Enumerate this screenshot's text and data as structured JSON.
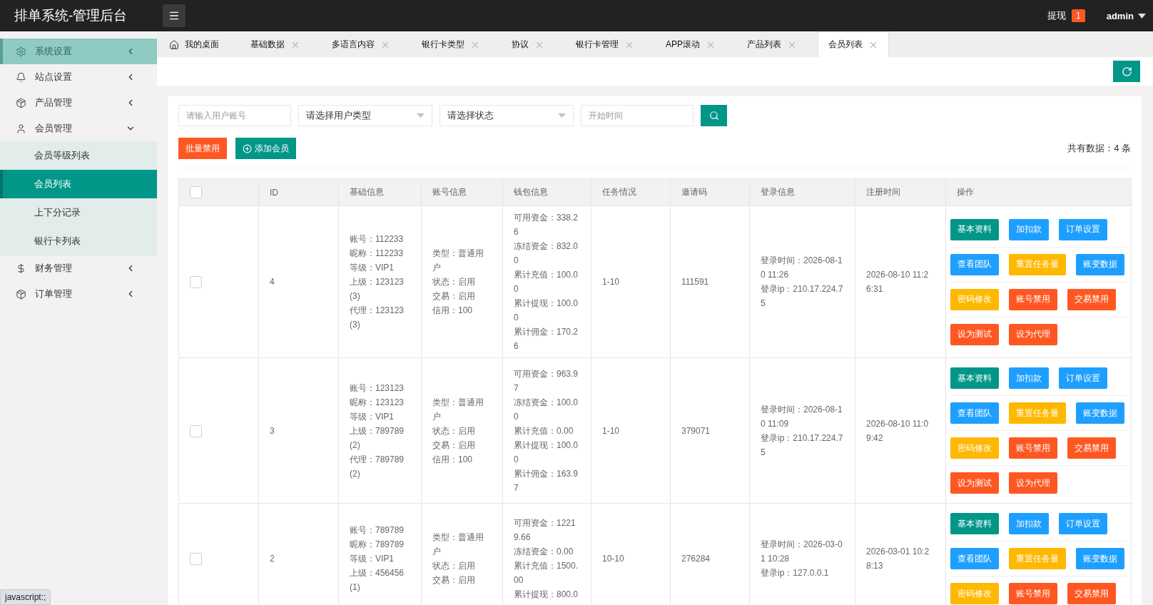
{
  "header": {
    "title": "排单系统-管理后台",
    "withdraw": {
      "label": "提现",
      "count": "1"
    },
    "user": "admin"
  },
  "sidebar": {
    "items": [
      {
        "label": "系统设置",
        "highlighted": true,
        "expanded": false
      },
      {
        "label": "站点设置",
        "highlighted": false,
        "expanded": false
      },
      {
        "label": "产品管理",
        "highlighted": false,
        "expanded": false
      },
      {
        "label": "会员管理",
        "highlighted": false,
        "expanded": true,
        "children": [
          {
            "label": "会员等级列表",
            "selected": false
          },
          {
            "label": "会员列表",
            "selected": true
          },
          {
            "label": "上下分记录",
            "selected": false
          },
          {
            "label": "银行卡列表",
            "selected": false
          }
        ]
      },
      {
        "label": "财务管理",
        "highlighted": false,
        "expanded": false
      },
      {
        "label": "订单管理",
        "highlighted": false,
        "expanded": false
      }
    ]
  },
  "tabs": [
    {
      "label": "我的桌面",
      "kind": "home",
      "selected": false
    },
    {
      "label": "基础数据",
      "kind": "closable",
      "selected": false
    },
    {
      "label": "多语言内容",
      "kind": "closable",
      "selected": false
    },
    {
      "label": "银行卡类型",
      "kind": "closable",
      "selected": false
    },
    {
      "label": "协议",
      "kind": "closable",
      "selected": false
    },
    {
      "label": "银行卡管理",
      "kind": "closable",
      "selected": false
    },
    {
      "label": "APP滚动",
      "kind": "closable",
      "selected": false
    },
    {
      "label": "产品列表",
      "kind": "closable",
      "selected": false
    },
    {
      "label": "会员列表",
      "kind": "closable",
      "selected": true
    }
  ],
  "filters": [
    {
      "kind": "text",
      "placeholder": "请输入用户账号"
    },
    {
      "kind": "select",
      "value": "请选择用户类型"
    },
    {
      "kind": "select",
      "value": "请选择状态"
    },
    {
      "kind": "text",
      "placeholder": "开始时间"
    }
  ],
  "toolbar": {
    "bulk_disable": "批量禁用",
    "add_member": "添加会员",
    "total": "共有数据：4 条"
  },
  "table": {
    "select_all_checked": false,
    "columns": [
      "ID",
      "基础信息",
      "账号信息",
      "钱包信息",
      "任务情况",
      "邀请码",
      "登录信息",
      "注册时间",
      "操作"
    ],
    "rows": [
      {
        "checked": false,
        "id": "4",
        "basic": [
          "账号：112233",
          "昵称：112233",
          "等级：VIP1",
          "上级：123123(3)",
          "代理：123123(3)"
        ],
        "account": [
          "类型：普通用户",
          "状态：启用",
          "交易：启用",
          "信用：100"
        ],
        "wallet": [
          "可用资金：338.26",
          "冻结资金：832.00",
          "累计充值：100.00",
          "累计提现：100.00",
          "累计佣金：170.26"
        ],
        "tasks": "1-10",
        "invite": "111591",
        "login": [
          "登录时间：2026-08-10 11:26",
          "登录ip：210.17.224.75"
        ],
        "registered": "2026-08-10 11:26:31",
        "actions": [
          [
            {
              "label": "基本资料",
              "kind": "primary"
            },
            {
              "label": "加扣款",
              "kind": "info"
            },
            {
              "label": "订单设置",
              "kind": "info"
            }
          ],
          [
            {
              "label": "查看团队",
              "kind": "info"
            },
            {
              "label": "重置任务量",
              "kind": "warn"
            },
            {
              "label": "账变数据",
              "kind": "info"
            }
          ],
          [
            {
              "label": "密码修改",
              "kind": "warn"
            },
            {
              "label": "账号禁用",
              "kind": "danger"
            },
            {
              "label": "交易禁用",
              "kind": "danger"
            }
          ],
          [
            {
              "label": "设为测试",
              "kind": "danger"
            },
            {
              "label": "设为代理",
              "kind": "danger"
            }
          ]
        ]
      },
      {
        "checked": false,
        "id": "3",
        "basic": [
          "账号：123123",
          "昵称：123123",
          "等级：VIP1",
          "上级：789789(2)",
          "代理：789789(2)"
        ],
        "account": [
          "类型：普通用户",
          "状态：启用",
          "交易：启用",
          "信用：100"
        ],
        "wallet": [
          "可用资金：963.97",
          "冻结资金：100.00",
          "累计充值：0.00",
          "累计提现：100.00",
          "累计佣金：163.97"
        ],
        "tasks": "1-10",
        "invite": "379071",
        "login": [
          "登录时间：2026-08-10 11:09",
          "登录ip：210.17.224.75"
        ],
        "registered": "2026-08-10 11:09:42",
        "actions": [
          [
            {
              "label": "基本资料",
              "kind": "primary"
            },
            {
              "label": "加扣款",
              "kind": "info"
            },
            {
              "label": "订单设置",
              "kind": "info"
            }
          ],
          [
            {
              "label": "查看团队",
              "kind": "info"
            },
            {
              "label": "重置任务量",
              "kind": "warn"
            },
            {
              "label": "账变数据",
              "kind": "info"
            }
          ],
          [
            {
              "label": "密码修改",
              "kind": "warn"
            },
            {
              "label": "账号禁用",
              "kind": "danger"
            },
            {
              "label": "交易禁用",
              "kind": "danger"
            }
          ],
          [
            {
              "label": "设为测试",
              "kind": "danger"
            },
            {
              "label": "设为代理",
              "kind": "danger"
            }
          ]
        ]
      },
      {
        "checked": false,
        "id": "2",
        "basic": [
          "账号：789789",
          "昵称：789789",
          "等级：VIP1",
          "上级：456456(1)"
        ],
        "account": [
          "类型：普通用户",
          "状态：启用",
          "交易：启用"
        ],
        "wallet": [
          "可用资金：12219.66",
          "冻结资金：0.00",
          "累计充值：1500.00",
          "累计提现：800.0"
        ],
        "tasks": "10-10",
        "invite": "276284",
        "login": [
          "登录时间：2026-03-01 10:28",
          "登录ip：127.0.0.1"
        ],
        "registered": "2026-03-01 10:28:13",
        "actions": [
          [
            {
              "label": "基本资料",
              "kind": "primary"
            },
            {
              "label": "加扣款",
              "kind": "info"
            },
            {
              "label": "订单设置",
              "kind": "info"
            }
          ],
          [
            {
              "label": "查看团队",
              "kind": "info"
            },
            {
              "label": "重置任务量",
              "kind": "warn"
            },
            {
              "label": "账变数据",
              "kind": "info"
            }
          ],
          [
            {
              "label": "密码修改",
              "kind": "warn"
            },
            {
              "label": "账号禁用",
              "kind": "danger"
            },
            {
              "label": "交易禁用",
              "kind": "danger"
            }
          ]
        ]
      }
    ]
  },
  "status_bar": "javascript:;"
}
